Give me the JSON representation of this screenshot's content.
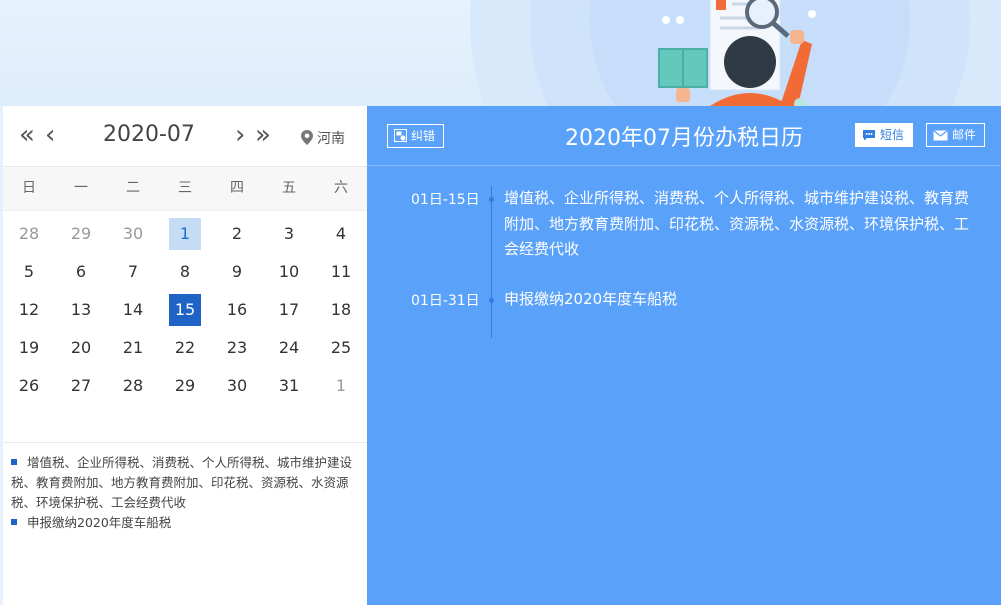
{
  "calendar": {
    "month": "2020-07",
    "region": "河南",
    "nav": {
      "prev_year": "«",
      "prev_month": "‹",
      "next_month": "›",
      "next_year": "»"
    },
    "weekdays": [
      "日",
      "一",
      "二",
      "三",
      "四",
      "五",
      "六"
    ],
    "weeks": [
      [
        {
          "d": "28",
          "other": true
        },
        {
          "d": "29",
          "other": true
        },
        {
          "d": "30",
          "other": true
        },
        {
          "d": "1",
          "hl": "light"
        },
        {
          "d": "2"
        },
        {
          "d": "3"
        },
        {
          "d": "4"
        }
      ],
      [
        {
          "d": "5"
        },
        {
          "d": "6"
        },
        {
          "d": "7"
        },
        {
          "d": "8"
        },
        {
          "d": "9"
        },
        {
          "d": "10"
        },
        {
          "d": "11"
        }
      ],
      [
        {
          "d": "12"
        },
        {
          "d": "13"
        },
        {
          "d": "14"
        },
        {
          "d": "15",
          "hl": "dark"
        },
        {
          "d": "16"
        },
        {
          "d": "17"
        },
        {
          "d": "18"
        }
      ],
      [
        {
          "d": "19"
        },
        {
          "d": "20"
        },
        {
          "d": "21"
        },
        {
          "d": "22"
        },
        {
          "d": "23"
        },
        {
          "d": "24"
        },
        {
          "d": "25"
        }
      ],
      [
        {
          "d": "26"
        },
        {
          "d": "27"
        },
        {
          "d": "28"
        },
        {
          "d": "29"
        },
        {
          "d": "30"
        },
        {
          "d": "31"
        },
        {
          "d": "1",
          "other": true
        }
      ]
    ]
  },
  "legend": [
    "增值税、企业所得税、消费税、个人所得税、城市维护建设税、教育费附加、地方教育费附加、印花税、资源税、水资源税、环境保护税、工会经费代收",
    "申报缴纳2020年度车船税"
  ],
  "panel": {
    "title": "2020年07月份办税日历",
    "correct_label": "纠错",
    "sms_label": "短信",
    "mail_label": "邮件",
    "items": [
      {
        "range": "01日-15日",
        "text": "增值税、企业所得税、消费税、个人所得税、城市维护建设税、教育费附加、地方教育费附加、印花税、资源税、水资源税、环境保护税、工会经费代收"
      },
      {
        "range": "01日-31日",
        "text": "申报缴纳2020年度车船税"
      }
    ]
  },
  "colors": {
    "panel_bg": "#5aa1fa",
    "accent": "#1f63c6",
    "highlight_light": "#c5dcf5"
  },
  "icons": [
    "location-pin-icon",
    "correct-icon",
    "sms-icon",
    "mail-icon"
  ]
}
